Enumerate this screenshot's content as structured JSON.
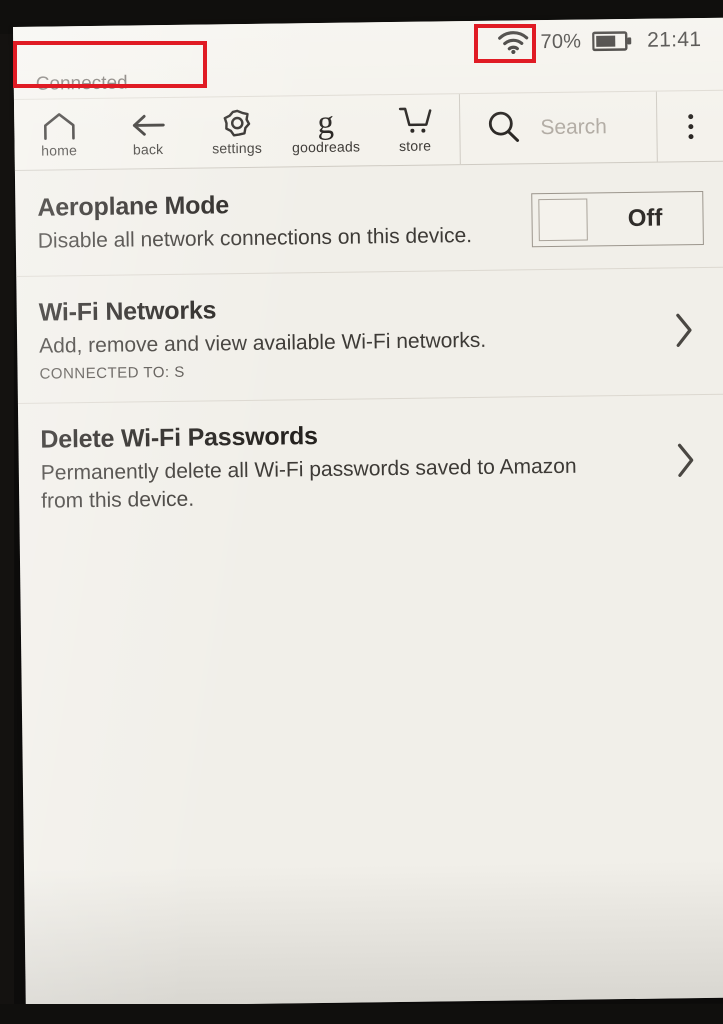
{
  "status_bar": {
    "wifi_icon": "wifi-icon",
    "battery_percent": "70%",
    "battery_icon": "battery-icon",
    "clock": "21:41"
  },
  "connection": {
    "status_label": "Connected"
  },
  "toolbar": {
    "items": [
      {
        "label": "home",
        "icon": "home-icon"
      },
      {
        "label": "back",
        "icon": "back-arrow-icon"
      },
      {
        "label": "settings",
        "icon": "gear-icon"
      },
      {
        "label": "goodreads",
        "icon": "goodreads-g-icon",
        "glyph": "g"
      },
      {
        "label": "store",
        "icon": "shopping-cart-icon"
      }
    ],
    "search": {
      "icon": "search-icon",
      "placeholder": "Search",
      "value": ""
    },
    "overflow_menu_icon": "three-dots-icon"
  },
  "settings": {
    "rows": [
      {
        "title": "Aeroplane Mode",
        "description": "Disable all network connections on this device.",
        "control": "toggle",
        "toggle_state": "Off"
      },
      {
        "title": "Wi-Fi Networks",
        "description": "Add, remove and view available Wi-Fi networks.",
        "sub_label": "CONNECTED TO: S",
        "control": "chevron"
      },
      {
        "title": "Delete Wi-Fi Passwords",
        "description": "Permanently delete all Wi-Fi passwords saved to Amazon from this device.",
        "control": "chevron"
      }
    ]
  },
  "annotations": {
    "accent_color": "#e01b24",
    "boxes": [
      {
        "name": "connected-label-highlight",
        "target": "Connected"
      },
      {
        "name": "wifi-icon-highlight",
        "target": "wifi-icon"
      }
    ]
  },
  "colors": {
    "screen_background": "#f1efe9",
    "chrome_background": "#f4f2ec",
    "text_primary": "#25221f",
    "text_secondary": "#3d3a36",
    "text_muted": "#68635d",
    "bezel": "#100f0d"
  }
}
